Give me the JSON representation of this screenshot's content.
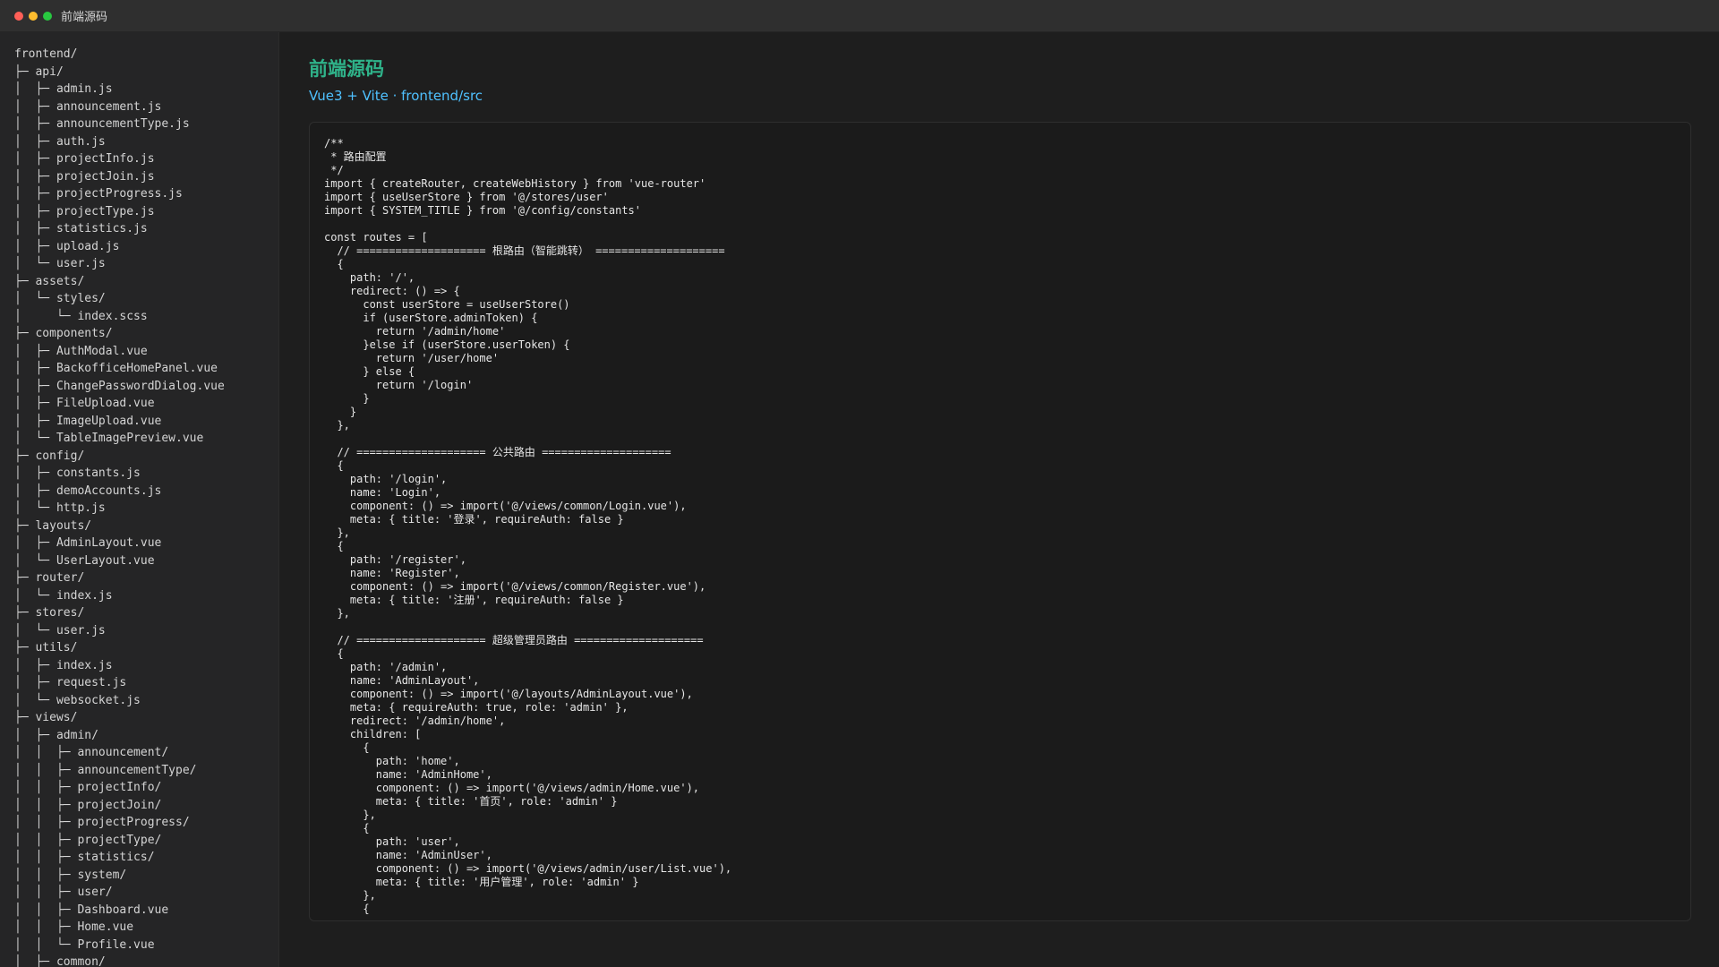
{
  "window": {
    "title": "前端源码"
  },
  "page": {
    "title": "前端源码",
    "subtitle": "Vue3 + Vite · frontend/src"
  },
  "file_tree": [
    "frontend/",
    "├─ api/",
    "│  ├─ admin.js",
    "│  ├─ announcement.js",
    "│  ├─ announcementType.js",
    "│  ├─ auth.js",
    "│  ├─ projectInfo.js",
    "│  ├─ projectJoin.js",
    "│  ├─ projectProgress.js",
    "│  ├─ projectType.js",
    "│  ├─ statistics.js",
    "│  ├─ upload.js",
    "│  └─ user.js",
    "├─ assets/",
    "│  └─ styles/",
    "│     └─ index.scss",
    "├─ components/",
    "│  ├─ AuthModal.vue",
    "│  ├─ BackofficeHomePanel.vue",
    "│  ├─ ChangePasswordDialog.vue",
    "│  ├─ FileUpload.vue",
    "│  ├─ ImageUpload.vue",
    "│  └─ TableImagePreview.vue",
    "├─ config/",
    "│  ├─ constants.js",
    "│  ├─ demoAccounts.js",
    "│  └─ http.js",
    "├─ layouts/",
    "│  ├─ AdminLayout.vue",
    "│  └─ UserLayout.vue",
    "├─ router/",
    "│  └─ index.js",
    "├─ stores/",
    "│  └─ user.js",
    "├─ utils/",
    "│  ├─ index.js",
    "│  ├─ request.js",
    "│  └─ websocket.js",
    "├─ views/",
    "│  ├─ admin/",
    "│  │  ├─ announcement/",
    "│  │  ├─ announcementType/",
    "│  │  ├─ projectInfo/",
    "│  │  ├─ projectJoin/",
    "│  │  ├─ projectProgress/",
    "│  │  ├─ projectType/",
    "│  │  ├─ statistics/",
    "│  │  ├─ system/",
    "│  │  ├─ user/",
    "│  │  ├─ Dashboard.vue",
    "│  │  ├─ Home.vue",
    "│  │  └─ Profile.vue",
    "│  ├─ common/"
  ],
  "code_text": "/**\n * 路由配置\n */\nimport { createRouter, createWebHistory } from 'vue-router'\nimport { useUserStore } from '@/stores/user'\nimport { SYSTEM_TITLE } from '@/config/constants'\n\nconst routes = [\n  // ==================== 根路由（智能跳转） ====================\n  {\n    path: '/',\n    redirect: () => {\n      const userStore = useUserStore()\n      if (userStore.adminToken) {\n        return '/admin/home'\n      }else if (userStore.userToken) {\n        return '/user/home'\n      } else {\n        return '/login'\n      }\n    }\n  },\n\n  // ==================== 公共路由 ====================\n  {\n    path: '/login',\n    name: 'Login',\n    component: () => import('@/views/common/Login.vue'),\n    meta: { title: '登录', requireAuth: false }\n  },\n  {\n    path: '/register',\n    name: 'Register',\n    component: () => import('@/views/common/Register.vue'),\n    meta: { title: '注册', requireAuth: false }\n  },\n\n  // ==================== 超级管理员路由 ====================\n  {\n    path: '/admin',\n    name: 'AdminLayout',\n    component: () => import('@/layouts/AdminLayout.vue'),\n    meta: { requireAuth: true, role: 'admin' },\n    redirect: '/admin/home',\n    children: [\n      {\n        path: 'home',\n        name: 'AdminHome',\n        component: () => import('@/views/admin/Home.vue'),\n        meta: { title: '首页', role: 'admin' }\n      },\n      {\n        path: 'user',\n        name: 'AdminUser',\n        component: () => import('@/views/admin/user/List.vue'),\n        meta: { title: '用户管理', role: 'admin' }\n      },\n      {"
}
